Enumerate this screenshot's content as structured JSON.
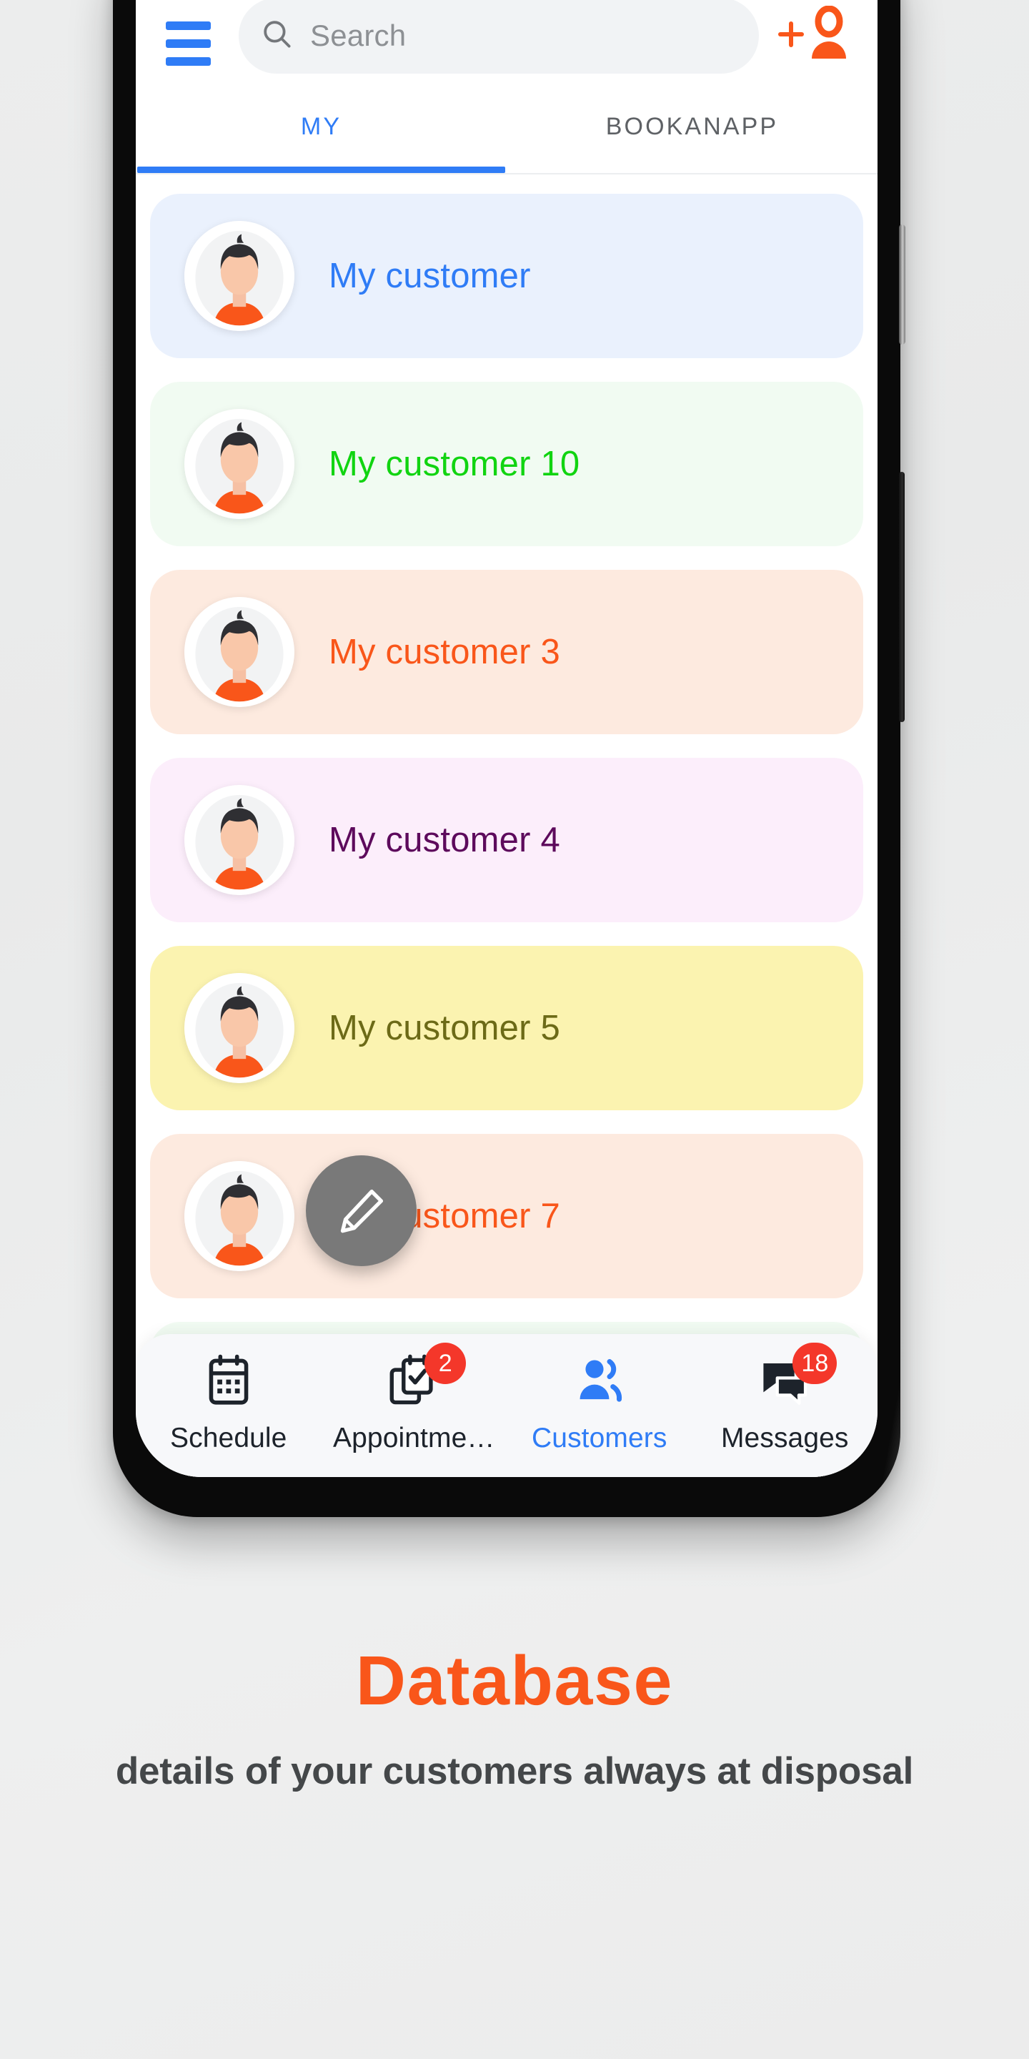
{
  "header": {
    "menu_icon": "hamburger-menu-icon",
    "search": {
      "icon": "search-icon",
      "placeholder": "Search",
      "value": ""
    },
    "add_customer_icon": "add-person-icon"
  },
  "tabs": [
    {
      "label": "MY",
      "active": true
    },
    {
      "label": "BOOKANAPP",
      "active": false
    }
  ],
  "customers": [
    {
      "name": "My customer",
      "bg": "#eaf1fd",
      "color": "#2f7cf6",
      "avatar": "person-avatar"
    },
    {
      "name": "My customer 10",
      "bg": "#f1fbf2",
      "color": "#11d411",
      "avatar": "person-avatar"
    },
    {
      "name": "My customer 3",
      "bg": "#fdeadf",
      "color": "#f9561a",
      "avatar": "person-avatar"
    },
    {
      "name": "My customer 4",
      "bg": "#fceefb",
      "color": "#5d0a5c",
      "avatar": "person-avatar"
    },
    {
      "name": "My customer 5",
      "bg": "#fbf3b0",
      "color": "#6c6a17",
      "avatar": "person-avatar"
    },
    {
      "name": "My customer 7",
      "bg": "#fdeadf",
      "color": "#f9561a",
      "avatar": "person-avatar"
    },
    {
      "name": "",
      "bg": "#f1fbf2",
      "color": "#11d411",
      "avatar": "person-avatar"
    }
  ],
  "fab": {
    "icon": "edit-pencil-icon",
    "color": "#797979"
  },
  "bottom_nav": [
    {
      "label": "Schedule",
      "icon": "calendar-icon",
      "badge": "",
      "active": false
    },
    {
      "label": "Appointme…",
      "icon": "clipboard-check-icon",
      "badge": "2",
      "active": false
    },
    {
      "label": "Customers",
      "icon": "people-icon",
      "badge": "",
      "active": true
    },
    {
      "label": "Messages",
      "icon": "chat-bubble-icon",
      "badge": "18",
      "active": false
    }
  ],
  "marketing": {
    "title": "Database",
    "subtitle": "details of your customers always at disposal"
  },
  "theme": {
    "accent_blue": "#2f7cf6",
    "accent_orange": "#f9561a",
    "badge_red": "#f4372a",
    "page_background": "#ececec",
    "phone_bezel": "#0a0a0a"
  }
}
